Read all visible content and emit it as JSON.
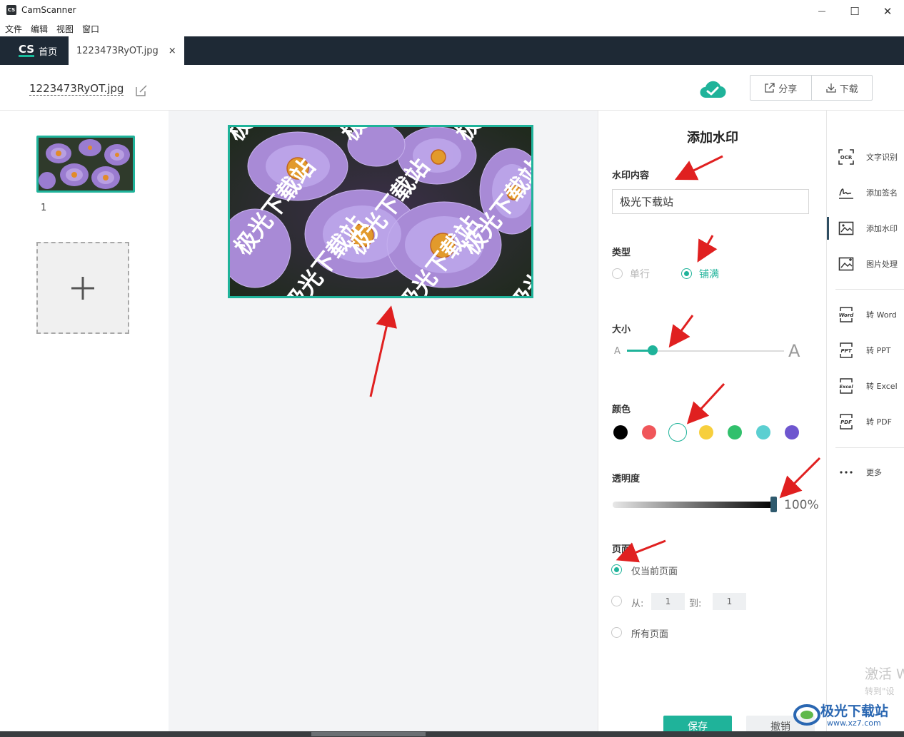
{
  "window": {
    "title": "CamScanner",
    "logo_text": "CS",
    "minimize": "—",
    "maximize": "☐",
    "close": "✕"
  },
  "menu": [
    "文件",
    "编辑",
    "视图",
    "窗口"
  ],
  "tabs": {
    "home_logo": "CS",
    "home_label": "首页",
    "file_label": "1223473RyOT.jpg",
    "close_glyph": "×"
  },
  "header": {
    "doc_name": "1223473RyOT.jpg",
    "share_label": "分享",
    "download_label": "下载"
  },
  "thumbnails": {
    "page_number": "1",
    "add_glyph": "+"
  },
  "preview": {
    "watermark_text": "极光下载站"
  },
  "watermark_panel": {
    "title": "添加水印",
    "content_label": "水印内容",
    "content_value": "极光下载站",
    "type_label": "类型",
    "type_options": [
      "单行",
      "铺满"
    ],
    "type_selected": "铺满",
    "size_label": "大小",
    "size_small": "A",
    "size_large": "A",
    "size_level": 0.17,
    "color_label": "颜色",
    "colors": [
      "#000000",
      "#f0565a",
      "#ffffff",
      "#f7cf3d",
      "#31c06c",
      "#5bcfd1",
      "#6e56cf"
    ],
    "color_selected": "#ffffff",
    "opacity_label": "透明度",
    "opacity_value": "100%",
    "page_label": "页面",
    "page_current": "仅当前页面",
    "page_from_label": "从:",
    "page_from_value": "1",
    "page_to_label": "到:",
    "page_to_value": "1",
    "page_all": "所有页面",
    "save_label": "保存",
    "cancel_label": "撤销"
  },
  "tools": [
    {
      "icon": "ocr-icon",
      "label": "文字识别"
    },
    {
      "icon": "signature-icon",
      "label": "添加签名"
    },
    {
      "icon": "watermark-icon",
      "label": "添加水印"
    },
    {
      "icon": "image-process-icon",
      "label": "图片处理"
    },
    {
      "icon": "word-icon",
      "label": "转 Word"
    },
    {
      "icon": "ppt-icon",
      "label": "转 PPT"
    },
    {
      "icon": "excel-icon",
      "label": "转 Excel"
    },
    {
      "icon": "pdf-icon",
      "label": "转 PDF"
    },
    {
      "icon": "more-icon",
      "label": "更多"
    }
  ],
  "system_overlay": {
    "activate_line1": "激活 W",
    "activate_line2": "转到\"设"
  },
  "site_watermark": {
    "name": "极光下载站",
    "url": "www.xz7.com"
  },
  "accent_color": "#1fb39a"
}
